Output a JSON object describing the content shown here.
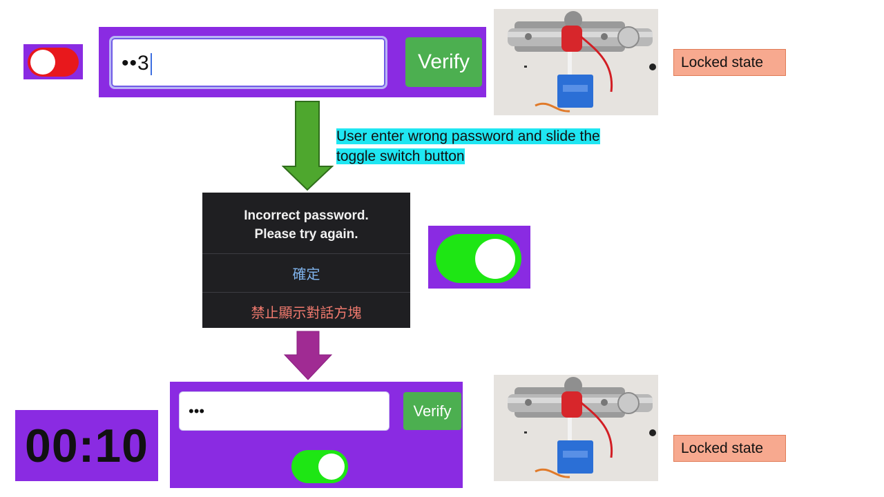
{
  "colors": {
    "panel": "#8a2be2",
    "verify": "#4caf50",
    "toggle_off": "#e8181c",
    "toggle_on": "#1ee614",
    "annotation_highlight": "#1fe6f2",
    "state_label": "#f7a98f",
    "dialog_bg": "#1f1f22",
    "dialog_confirm": "#7fb3ec",
    "dialog_suppress": "#f07a6e",
    "arrow_green": "#4ea72e",
    "arrow_purple": "#a02b93"
  },
  "top": {
    "password_value": "••3",
    "verify_label": "Verify",
    "toggle_state": "off",
    "state_label": "Locked state"
  },
  "annotation": {
    "text": "User enter wrong password and slide the toggle switch button"
  },
  "dialog": {
    "message_line1": "Incorrect password.",
    "message_line2": "Please try again.",
    "confirm_label": "確定",
    "suppress_label": "禁止顯示對話方塊"
  },
  "middle_toggle": {
    "state": "on"
  },
  "bottom": {
    "timer": "00:10",
    "password_value": "•••",
    "verify_label": "Verify",
    "toggle_state": "on",
    "state_label": "Locked state"
  },
  "icons": {
    "down_arrow_1": "down-arrow-icon",
    "down_arrow_2": "down-arrow-icon"
  }
}
